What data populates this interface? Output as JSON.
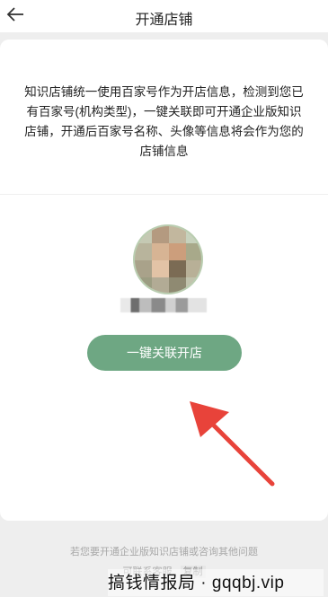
{
  "header": {
    "title": "开通店铺",
    "back_icon": "arrow-left-icon"
  },
  "notice": {
    "text": "知识店铺统一使用百家号作为开店信息，检测到您已有百家号(机构类型)，一键关联即可开通企业版知识店铺，开通后百家号名称、头像等信息将会作为您的店铺信息"
  },
  "account": {
    "avatar": "blurred-avatar",
    "name": "blurred-account-name"
  },
  "action": {
    "label": "一键关联开店",
    "color": "#6ea783"
  },
  "annotation": {
    "arrow_color": "#e8433a"
  },
  "footer": {
    "line1": "若您要开通企业版知识店铺或咨询其他问题",
    "line2_prefix": "可联系客服",
    "copy_label": "复制"
  },
  "watermark": {
    "text": "搞钱情报局 · gqqbj.vip"
  }
}
